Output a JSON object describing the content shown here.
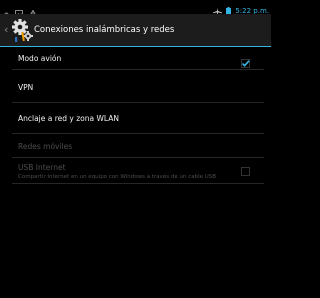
{
  "status_bar": {
    "time": "5:22 p.m.",
    "icons": [
      "notification-icon",
      "gallery-icon",
      "warning-icon",
      "airplane-icon",
      "battery-icon"
    ]
  },
  "action_bar": {
    "title": "Conexiones inalámbricas y redes",
    "icon": "settings-gear-icon"
  },
  "settings": [
    {
      "title": "Modo avión",
      "enabled": true,
      "checkbox": true,
      "checked": true
    },
    {
      "title": "VPN",
      "enabled": true
    },
    {
      "title": "Anclaje a red y zona WLAN",
      "enabled": true
    },
    {
      "title": "Redes móviles",
      "enabled": false
    },
    {
      "title": "USB Internet",
      "summary": "Compartir Internet en un equipo con Windows a través de un cable USB",
      "enabled": false,
      "checkbox": true,
      "checked": false
    }
  ],
  "colors": {
    "accent": "#33b5e5",
    "background": "#000000",
    "action_bar": "#1c1c1c",
    "disabled_text": "#4d4d4d"
  }
}
